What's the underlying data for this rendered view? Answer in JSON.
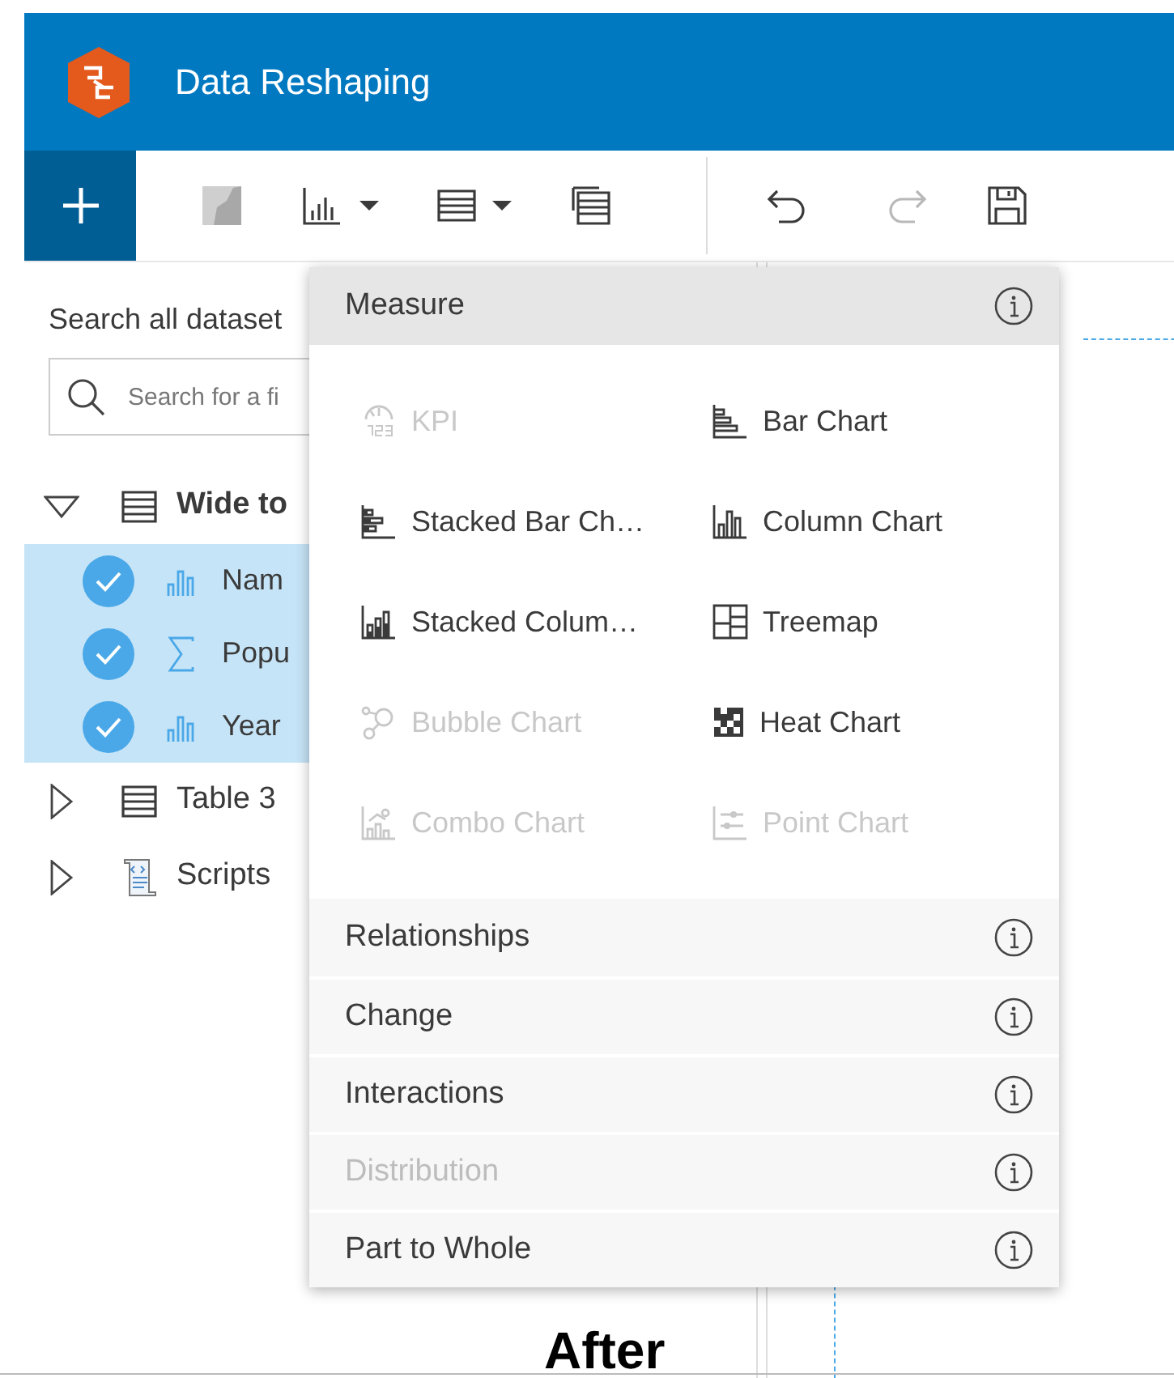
{
  "header": {
    "title": "Data Reshaping"
  },
  "toolbar": [
    {
      "kind": "add",
      "disabled": false
    },
    {
      "kind": "map",
      "disabled": true
    },
    {
      "kind": "chart",
      "disabled": false
    },
    {
      "kind": "table",
      "disabled": false
    },
    {
      "kind": "tables",
      "disabled": false
    },
    {
      "kind": "undo",
      "disabled": false
    },
    {
      "kind": "redo",
      "disabled": true
    },
    {
      "kind": "save",
      "disabled": false
    }
  ],
  "sidebar": {
    "search_label": "Search all dataset",
    "search_field": {
      "placeholder": "Search for a fi"
    },
    "tree": [
      {
        "label": "Wide to",
        "kind": "table",
        "expanded": true,
        "children": [
          {
            "label": "Nam",
            "kind": "string",
            "selected": true
          },
          {
            "label": "Popu",
            "kind": "number",
            "selected": true
          },
          {
            "label": "Year",
            "kind": "string",
            "selected": true
          }
        ]
      },
      {
        "label": "Table 3",
        "kind": "table",
        "expanded": false
      },
      {
        "label": "Scripts",
        "kind": "scripts",
        "expanded": false
      }
    ]
  },
  "menu": {
    "categories": [
      {
        "label": "Measure",
        "expanded": true,
        "disabled": false,
        "items": [
          {
            "label": "KPI",
            "disabled": true
          },
          {
            "label": "Bar Chart",
            "disabled": false
          },
          {
            "label": "Stacked Bar Ch…",
            "disabled": false
          },
          {
            "label": "Column Chart",
            "disabled": false
          },
          {
            "label": "Stacked Colum…",
            "disabled": false
          },
          {
            "label": "Treemap",
            "disabled": false
          },
          {
            "label": "Bubble Chart",
            "disabled": true
          },
          {
            "label": "Heat Chart",
            "disabled": false
          },
          {
            "label": "Combo Chart",
            "disabled": true
          },
          {
            "label": "Point Chart",
            "disabled": true
          }
        ]
      },
      {
        "label": "Relationships",
        "expanded": false,
        "disabled": false
      },
      {
        "label": "Change",
        "expanded": false,
        "disabled": false
      },
      {
        "label": "Interactions",
        "expanded": false,
        "disabled": false
      },
      {
        "label": "Distribution",
        "expanded": false,
        "disabled": true
      },
      {
        "label": "Part to Whole",
        "expanded": false,
        "disabled": false
      }
    ]
  },
  "caption": "After"
}
